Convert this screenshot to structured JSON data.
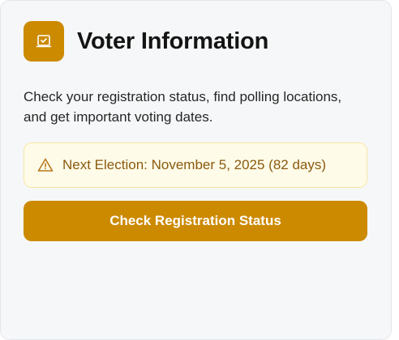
{
  "card": {
    "title": "Voter Information",
    "title_icon": "ballot-box-icon",
    "description": "Check your registration status, find polling locations, and get important voting dates.",
    "notice": {
      "icon": "warning-triangle-icon",
      "text": "Next Election: November 5, 2025 (82 days)"
    },
    "button": {
      "label": "Check Registration Status"
    }
  },
  "colors": {
    "accent": "#cc8a00",
    "card_background": "#f6f7f8",
    "notice_background": "#fefbe8",
    "notice_border": "#f6e7a4",
    "notice_text": "#8a5a0f",
    "title_text": "#141414"
  }
}
